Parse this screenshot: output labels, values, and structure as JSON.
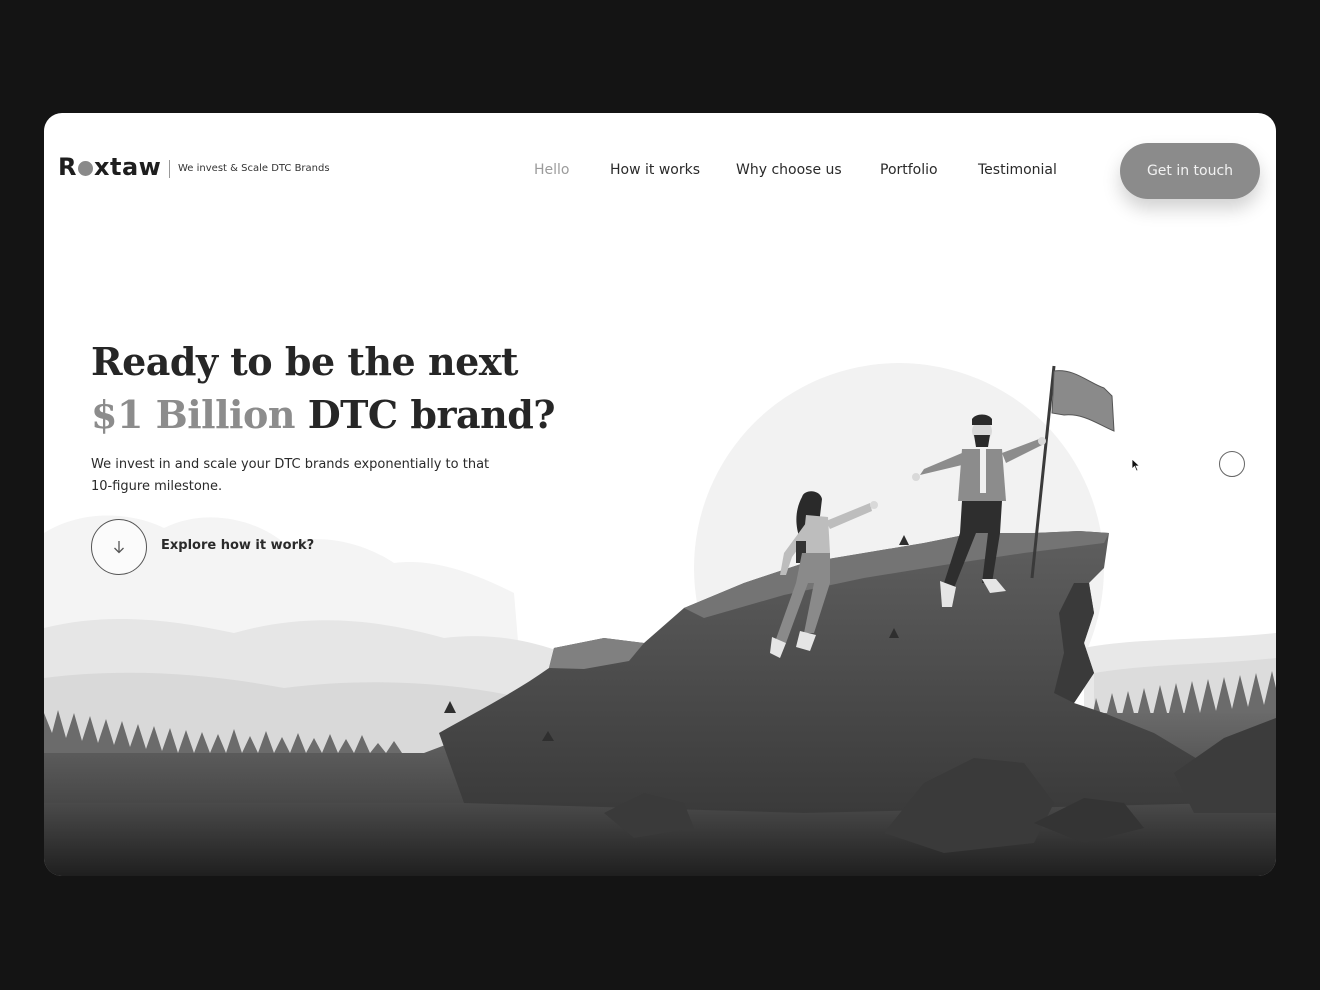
{
  "brand": {
    "logo_text_before": "R",
    "logo_text_after": "xtaw",
    "tagline": "We invest & Scale DTC Brands"
  },
  "nav": {
    "items": [
      {
        "label": "Hello",
        "active": true
      },
      {
        "label": "How it works",
        "active": false
      },
      {
        "label": "Why choose us",
        "active": false
      },
      {
        "label": "Portfolio",
        "active": false
      },
      {
        "label": "Testimonial",
        "active": false
      }
    ],
    "cta_label": "Get in touch"
  },
  "hero": {
    "title_line1": "Ready to be the next",
    "title_accent": "$1 Billion",
    "title_rest": "DTC brand?",
    "subtitle_line1": "We invest in and scale your DTC brands exponentially to that",
    "subtitle_line2": "10-figure milestone.",
    "explore_label": "Explore how it work?"
  },
  "colors": {
    "page_background": "#141414",
    "card_background": "#ffffff",
    "accent_gray": "#8b8b8b",
    "text_dark": "#262626"
  },
  "icons": {
    "explore": "arrow-down-icon",
    "cursor": "mouse-pointer-icon"
  }
}
